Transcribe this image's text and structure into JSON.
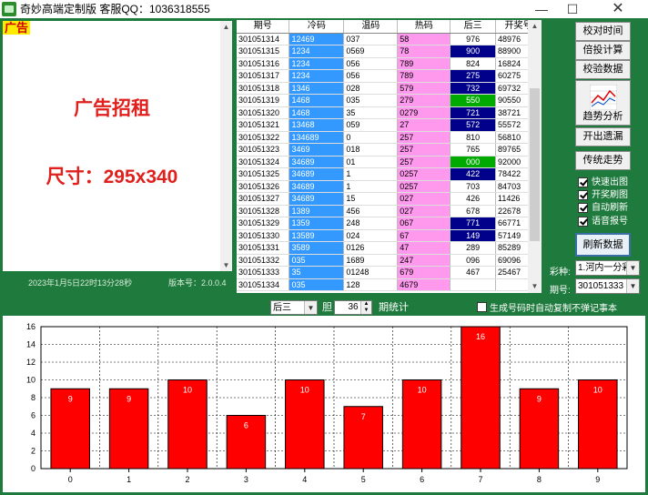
{
  "window": {
    "title": "奇妙高端定制版 客服QQ：1036318555",
    "min": "—",
    "max": "☐",
    "close": "✕"
  },
  "ad": {
    "tag": "广告",
    "title": "广告招租",
    "size": "尺寸：295x340",
    "datetime": "2023年1月5日22时13分28秒",
    "version": "版本号：2.0.0.4"
  },
  "table": {
    "headers": [
      "期号",
      "冷码",
      "温码",
      "热码",
      "后三",
      "开奖号"
    ],
    "rows": [
      {
        "id": "301051314",
        "cold": "12469",
        "warm": "037",
        "hot": "58",
        "back": "976",
        "hl": "",
        "num": "48976"
      },
      {
        "id": "301051315",
        "cold": "1234",
        "warm": "0569",
        "hot": "78",
        "back": "900",
        "hl": "blue",
        "num": "88900"
      },
      {
        "id": "301051316",
        "cold": "1234",
        "warm": "056",
        "hot": "789",
        "back": "824",
        "hl": "",
        "num": "16824"
      },
      {
        "id": "301051317",
        "cold": "1234",
        "warm": "056",
        "hot": "789",
        "back": "275",
        "hl": "blue",
        "num": "60275"
      },
      {
        "id": "301051318",
        "cold": "1346",
        "warm": "028",
        "hot": "579",
        "back": "732",
        "hl": "blue",
        "num": "69732"
      },
      {
        "id": "301051319",
        "cold": "1468",
        "warm": "035",
        "hot": "279",
        "back": "550",
        "hl": "green",
        "num": "90550"
      },
      {
        "id": "301051320",
        "cold": "1468",
        "warm": "35",
        "hot": "0279",
        "back": "721",
        "hl": "blue",
        "num": "38721"
      },
      {
        "id": "301051321",
        "cold": "13468",
        "warm": "059",
        "hot": "27",
        "back": "572",
        "hl": "blue",
        "num": "55572"
      },
      {
        "id": "301051322",
        "cold": "134689",
        "warm": "0",
        "hot": "257",
        "back": "810",
        "hl": "",
        "num": "56810"
      },
      {
        "id": "301051323",
        "cold": "3469",
        "warm": "018",
        "hot": "257",
        "back": "765",
        "hl": "",
        "num": "89765"
      },
      {
        "id": "301051324",
        "cold": "34689",
        "warm": "01",
        "hot": "257",
        "back": "000",
        "hl": "green",
        "num": "92000"
      },
      {
        "id": "301051325",
        "cold": "34689",
        "warm": "1",
        "hot": "0257",
        "back": "422",
        "hl": "blue",
        "num": "78422"
      },
      {
        "id": "301051326",
        "cold": "34689",
        "warm": "1",
        "hot": "0257",
        "back": "703",
        "hl": "",
        "num": "84703"
      },
      {
        "id": "301051327",
        "cold": "34689",
        "warm": "15",
        "hot": "027",
        "back": "426",
        "hl": "",
        "num": "11426"
      },
      {
        "id": "301051328",
        "cold": "1389",
        "warm": "456",
        "hot": "027",
        "back": "678",
        "hl": "",
        "num": "22678"
      },
      {
        "id": "301051329",
        "cold": "1359",
        "warm": "248",
        "hot": "067",
        "back": "771",
        "hl": "blue",
        "num": "66771"
      },
      {
        "id": "301051330",
        "cold": "13589",
        "warm": "024",
        "hot": "67",
        "back": "149",
        "hl": "blue",
        "num": "57149"
      },
      {
        "id": "301051331",
        "cold": "3589",
        "warm": "0126",
        "hot": "47",
        "back": "289",
        "hl": "",
        "num": "85289"
      },
      {
        "id": "301051332",
        "cold": "035",
        "warm": "1689",
        "hot": "247",
        "back": "096",
        "hl": "",
        "num": "69096"
      },
      {
        "id": "301051333",
        "cold": "35",
        "warm": "01248",
        "hot": "679",
        "back": "467",
        "hl": "",
        "num": "25467"
      },
      {
        "id": "301051334",
        "cold": "035",
        "warm": "128",
        "hot": "4679",
        "back": "",
        "hl": "",
        "num": ""
      }
    ]
  },
  "right_panel": {
    "btn_calibrate_time": "校对时间",
    "btn_multiple_calc": "倍投计算",
    "btn_verify_data": "校验数据",
    "btn_trend_analysis": "趋势分析",
    "btn_missing": "开出遗漏",
    "btn_trend_walk": "传统走势",
    "chk_quick_chart": "快速出图",
    "chk_open_refresh": "开奖刷图",
    "chk_auto_refresh": "自动刷新",
    "chk_voice": "语音报号",
    "btn_refresh": "刷新数据",
    "label_type": "彩种:",
    "type_value": "1.河内一分彩",
    "label_period": "期号:",
    "period_value": "301051333"
  },
  "mid_controls": {
    "position_value": "后三",
    "dan_label": "胆",
    "count_value": "36",
    "stat_label": "期统计",
    "copy_label": "生成号码时自动复制不弹记事本"
  },
  "chart_data": {
    "type": "bar",
    "categories": [
      "0",
      "1",
      "2",
      "3",
      "4",
      "5",
      "6",
      "7",
      "8",
      "9"
    ],
    "values": [
      9,
      9,
      10,
      6,
      10,
      7,
      10,
      16,
      9,
      10
    ],
    "title": "",
    "xlabel": "",
    "ylabel": "",
    "ylim": [
      0,
      16
    ],
    "yticks": [
      0,
      2,
      4,
      6,
      8,
      10,
      12,
      14,
      16
    ],
    "bar_color": "#ff0000",
    "grid": true
  }
}
